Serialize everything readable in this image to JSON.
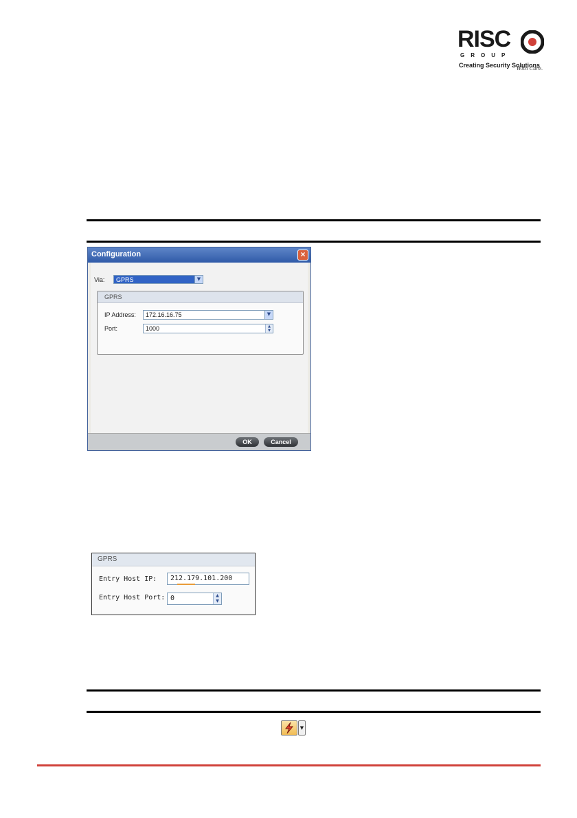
{
  "logo": {
    "brand": "RISC",
    "group": "GROUP",
    "tagline": "Creating Security Solutions",
    "tagline_script": "With Care."
  },
  "config_window": {
    "title": "Configuration",
    "close_glyph": "×",
    "via_label": "Via:",
    "via_value": "GPRS",
    "group_title": "GPRS",
    "ip_label": "IP Address:",
    "ip_value": "172.16.16.75",
    "port_label": "Port:",
    "port_value": "1000",
    "ok_label": "OK",
    "cancel_label": "Cancel"
  },
  "gprs_panel": {
    "title": "GPRS",
    "host_ip_label": "Entry Host IP:",
    "host_ip_value": "212.179.101.200",
    "host_port_label": "Entry Host Port:",
    "host_port_value": "0"
  },
  "icons": {
    "dropdown": "chevron-down-icon",
    "spinner": "spinner-arrows-icon",
    "toolbar": "lightning-icon",
    "toolbar_dropdown": "dropdown-arrow-icon"
  },
  "colors": {
    "accent_bottom_line": "#d0413a",
    "window_title_bar": "#3f6bb8",
    "via_selected": "#3163c5"
  }
}
